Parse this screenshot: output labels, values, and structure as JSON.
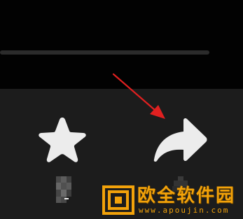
{
  "player": {
    "progress_fraction": 0.0
  },
  "actions": {
    "favorite": {
      "icon": "star-icon",
      "count_state": "pixelated"
    },
    "share": {
      "icon": "share-arrow-icon",
      "count_state": "pixelated"
    }
  },
  "annotation": {
    "icon": "red-arrow-pointer",
    "color": "#e02020"
  },
  "watermark": {
    "title": "欧全软件园",
    "domain": "www.apoujin.com",
    "color": "#f2a20a"
  }
}
